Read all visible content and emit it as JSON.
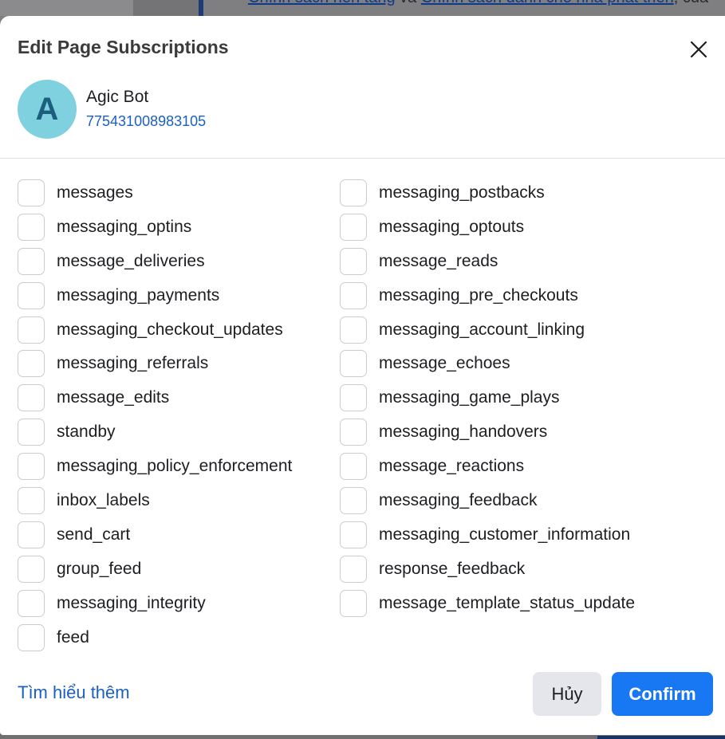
{
  "background": {
    "text_link_1": "Chính sách nền tảng",
    "text_mid": " và ",
    "text_link_2": "Chính sách dành cho nhà phát triển",
    "text_tail": ", của"
  },
  "modal": {
    "title": "Edit Page Subscriptions",
    "close_icon": "close-icon"
  },
  "page": {
    "avatar_letter": "A",
    "avatar_color": "#7fd1e0",
    "name": "Agic Bot",
    "id": "775431008983105"
  },
  "fields": [
    {
      "label": "messages",
      "checked": false
    },
    {
      "label": "messaging_postbacks",
      "checked": false
    },
    {
      "label": "messaging_optins",
      "checked": false
    },
    {
      "label": "messaging_optouts",
      "checked": false
    },
    {
      "label": "message_deliveries",
      "checked": false
    },
    {
      "label": "message_reads",
      "checked": false
    },
    {
      "label": "messaging_payments",
      "checked": false
    },
    {
      "label": "messaging_pre_checkouts",
      "checked": false
    },
    {
      "label": "messaging_checkout_updates",
      "checked": false
    },
    {
      "label": "messaging_account_linking",
      "checked": false
    },
    {
      "label": "messaging_referrals",
      "checked": false
    },
    {
      "label": "message_echoes",
      "checked": false
    },
    {
      "label": "message_edits",
      "checked": false
    },
    {
      "label": "messaging_game_plays",
      "checked": false
    },
    {
      "label": "standby",
      "checked": false
    },
    {
      "label": "messaging_handovers",
      "checked": false
    },
    {
      "label": "messaging_policy_enforcement",
      "checked": false
    },
    {
      "label": "message_reactions",
      "checked": false
    },
    {
      "label": "inbox_labels",
      "checked": false
    },
    {
      "label": "messaging_feedback",
      "checked": false
    },
    {
      "label": "send_cart",
      "checked": false
    },
    {
      "label": "messaging_customer_information",
      "checked": false
    },
    {
      "label": "group_feed",
      "checked": false
    },
    {
      "label": "response_feedback",
      "checked": false
    },
    {
      "label": "messaging_integrity",
      "checked": false
    },
    {
      "label": "message_template_status_update",
      "checked": false
    },
    {
      "label": "feed",
      "checked": false
    }
  ],
  "footer": {
    "learn_more": "Tìm hiểu thêm",
    "cancel_label": "Hủy",
    "confirm_label": "Confirm",
    "confirm_color": "#1877f2"
  }
}
